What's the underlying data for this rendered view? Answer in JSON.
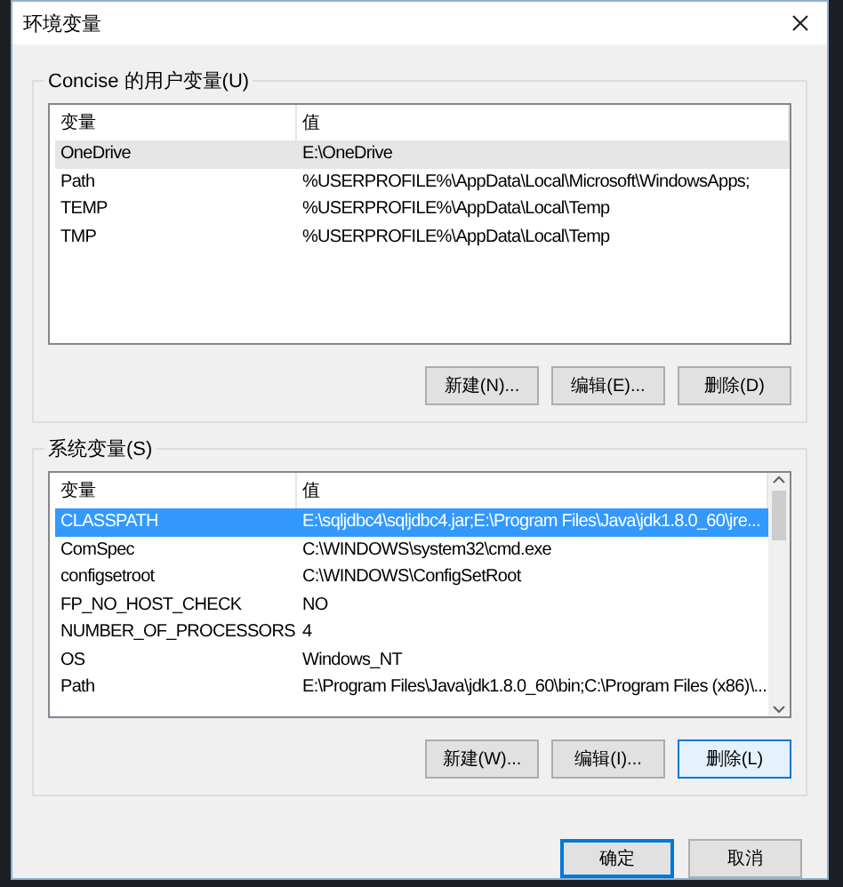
{
  "window": {
    "title": "环境变量"
  },
  "user_variables": {
    "label": "Concise 的用户变量(U)",
    "focused": false,
    "columns": [
      "变量",
      "值"
    ],
    "scrollbar": false,
    "rows": [
      {
        "name": "OneDrive",
        "value": "E:\\OneDrive",
        "selected": true
      },
      {
        "name": "Path",
        "value": "%USERPROFILE%\\AppData\\Local\\Microsoft\\WindowsApps;",
        "selected": false
      },
      {
        "name": "TEMP",
        "value": "%USERPROFILE%\\AppData\\Local\\Temp",
        "selected": false
      },
      {
        "name": "TMP",
        "value": "%USERPROFILE%\\AppData\\Local\\Temp",
        "selected": false
      }
    ],
    "buttons": [
      {
        "label": "新建(N)...",
        "focused": false
      },
      {
        "label": "编辑(E)...",
        "focused": false
      },
      {
        "label": "删除(D)",
        "focused": false
      }
    ]
  },
  "system_variables": {
    "label": "系统变量(S)",
    "focused": true,
    "columns": [
      "变量",
      "值"
    ],
    "scrollbar": true,
    "rows": [
      {
        "name": "CLASSPATH",
        "value": "E:\\sqljdbc4\\sqljdbc4.jar;E:\\Program Files\\Java\\jdk1.8.0_60\\jre...",
        "selected": true
      },
      {
        "name": "ComSpec",
        "value": "C:\\WINDOWS\\system32\\cmd.exe",
        "selected": false
      },
      {
        "name": "configsetroot",
        "value": "C:\\WINDOWS\\ConfigSetRoot",
        "selected": false
      },
      {
        "name": "FP_NO_HOST_CHECK",
        "value": "NO",
        "selected": false
      },
      {
        "name": "NUMBER_OF_PROCESSORS",
        "value": "4",
        "selected": false
      },
      {
        "name": "OS",
        "value": "Windows_NT",
        "selected": false
      },
      {
        "name": "Path",
        "value": "E:\\Program Files\\Java\\jdk1.8.0_60\\bin;C:\\Program Files (x86)\\...",
        "selected": false
      }
    ],
    "buttons": [
      {
        "label": "新建(W)...",
        "focused": false
      },
      {
        "label": "编辑(I)...",
        "focused": false
      },
      {
        "label": "删除(L)",
        "focused": true
      }
    ]
  },
  "dialog_buttons": [
    {
      "label": "确定",
      "default": true
    },
    {
      "label": "取消",
      "default": false
    }
  ]
}
